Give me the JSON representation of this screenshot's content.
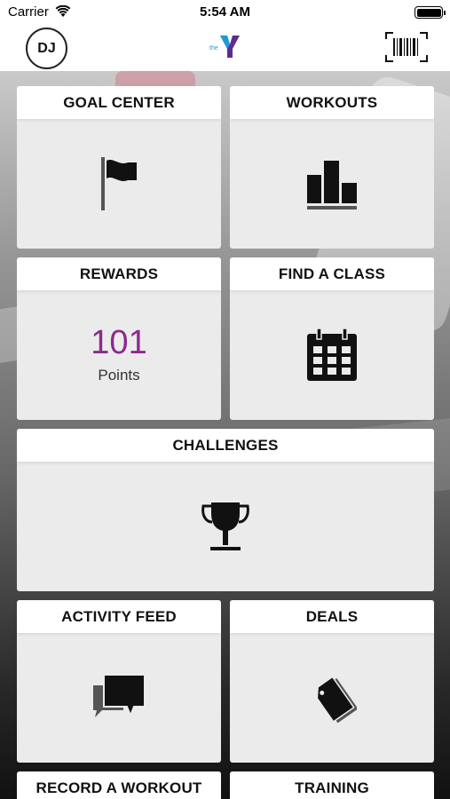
{
  "status_bar": {
    "carrier": "Carrier",
    "time": "5:54 AM"
  },
  "nav": {
    "avatar_initials": "DJ",
    "logo_text": "the"
  },
  "tiles": {
    "goal_center": {
      "title": "GOAL CENTER",
      "icon": "flag-icon"
    },
    "workouts": {
      "title": "WORKOUTS",
      "icon": "bar-chart-icon"
    },
    "rewards": {
      "title": "REWARDS",
      "points": "101",
      "points_label": "Points"
    },
    "find_a_class": {
      "title": "FIND A CLASS",
      "icon": "calendar-icon"
    },
    "challenges": {
      "title": "CHALLENGES",
      "icon": "trophy-icon"
    },
    "activity_feed": {
      "title": "ACTIVITY FEED",
      "icon": "chat-bubbles-icon"
    },
    "deals": {
      "title": "DEALS",
      "icon": "price-tag-icon"
    },
    "record_a_workout": {
      "title": "RECORD A WORKOUT"
    },
    "training": {
      "title": "TRAINING"
    }
  },
  "colors": {
    "accent_points": "#8b2a8c",
    "logo_blue": "#1e9bd7",
    "logo_purple": "#5c2d91"
  }
}
